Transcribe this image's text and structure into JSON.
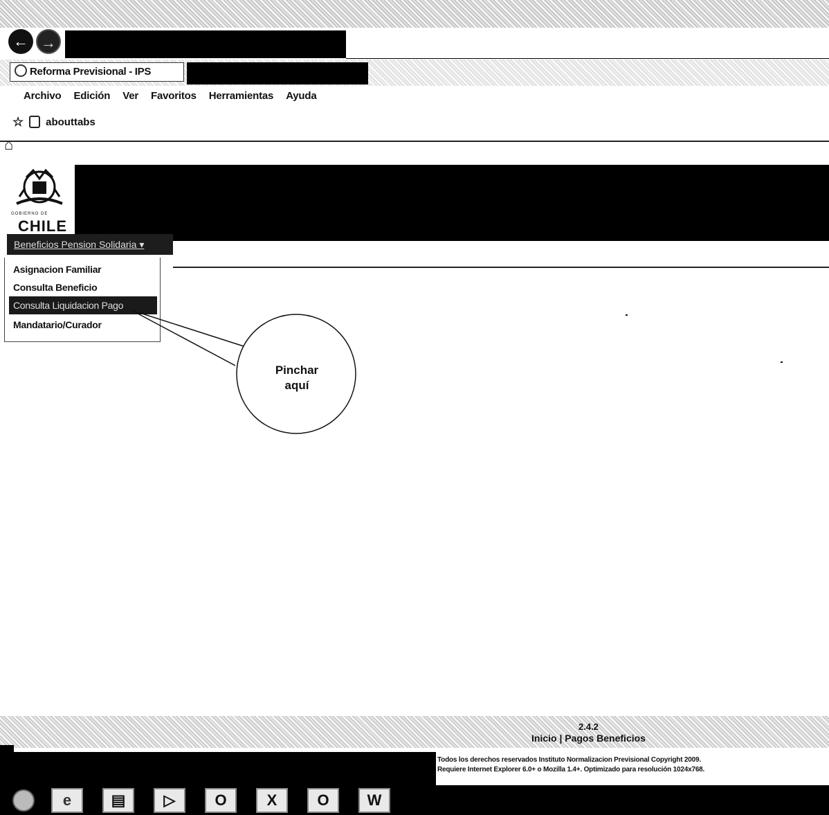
{
  "browser": {
    "tab_title": "Reforma Previsional - IPS",
    "menu": [
      "Archivo",
      "Edición",
      "Ver",
      "Favoritos",
      "Herramientas",
      "Ayuda"
    ],
    "favorites_item": "abouttabs"
  },
  "site": {
    "logo_text": "CHILE",
    "logo_subtext": "GOBIERNO DE",
    "nav_button": "Beneficios Pension Solidaria",
    "dropdown": [
      "Asignacion Familiar",
      "Consulta Beneficio",
      "Consulta Liquidacion Pago",
      "Mandatario/Curador"
    ]
  },
  "callout": {
    "line1": "Pinchar",
    "line2": "aquí"
  },
  "footer": {
    "version": "2.4.2",
    "links": "Inicio | Pagos Beneficios",
    "copyright_line1": "Todos los derechos reservados Instituto Normalizacion Previsional Copyright 2009.",
    "copyright_line2": "Requiere Internet Explorer 6.0+ o Mozilla 1.4+. Optimizado para resolución 1024x768."
  },
  "taskbar": {
    "icons": [
      "start-orb-icon",
      "internet-explorer-icon",
      "file-explorer-icon",
      "media-player-icon",
      "outlook-icon",
      "excel-icon",
      "outlook-mail-icon",
      "word-icon"
    ]
  }
}
